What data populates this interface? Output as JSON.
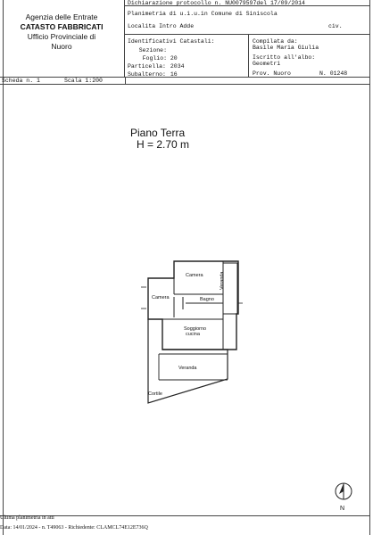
{
  "header": {
    "agency": [
      "Agenzia delle Entrate",
      "CATASTO FABBRICATI",
      "Ufficio Provinciale di",
      "Nuoro"
    ],
    "protocol_label": "Dichiarazione protocollo n.",
    "protocol_number": "NU0079597",
    "protocol_date_label": "del",
    "protocol_date": "17/09/2014",
    "plan_title": "Planimetria di u.i.u.in Comune di Siniscola",
    "location_label": "Localita Intro Adde",
    "civ_label": "civ.",
    "identifiers_title": "Identificativi Catastali:",
    "sezione_label": "Sezione:",
    "sezione_value": "",
    "foglio_label": "Foglio:",
    "foglio_value": "20",
    "particella_label": "Particella:",
    "particella_value": "2034",
    "subalterno_label": "Subalterno:",
    "subalterno_value": "16",
    "compiled_by_label": "Compilata da:",
    "compiled_by_name": "Basile Maria Giulia",
    "registered_label": "Iscritto all'albo:",
    "registered_value": "Geometri",
    "province_label": "Prov. Nuoro",
    "number_label": "N. 01248",
    "scheda": "Scheda n. 1",
    "scala": "Scala 1:200"
  },
  "plan": {
    "floor_title": "Piano Terra",
    "height": "H = 2.70 m",
    "rooms": {
      "camera1": "Camera",
      "camera2": "Camera",
      "bagno": "Bagno",
      "veranda_side": "Veranda",
      "soggiorno1": "Soggiorno",
      "soggiorno2": "cucina",
      "veranda": "Veranda",
      "cortile": "Cortile"
    },
    "north": "N"
  },
  "footer": {
    "line1": "Ultima planimetria in atti",
    "line2": "Data: 14/01/2024 - n. T49063 - Richiedente: CLAMCL74E12E736Q"
  }
}
